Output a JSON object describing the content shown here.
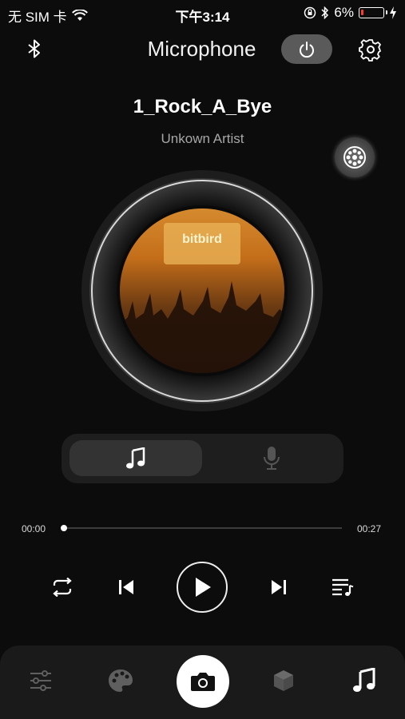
{
  "status_bar": {
    "carrier": "无 SIM 卡",
    "time": "下午3:14",
    "battery": "6%",
    "battery_level": 0.06,
    "battery_color": "#ff3b30"
  },
  "header": {
    "title": "Microphone",
    "icons": [
      "bluetooth-icon",
      "power-icon",
      "gear-icon"
    ]
  },
  "track": {
    "title": "1_Rock_A_Bye",
    "artist": "Unkown Artist",
    "album_art_label": "bitbird"
  },
  "mode_switch": {
    "options": [
      "music-note-icon",
      "microphone-icon"
    ],
    "selected": "music"
  },
  "progress": {
    "elapsed": "00:00",
    "total": "00:27",
    "fraction": 0.0
  },
  "controls": [
    "repeat-icon",
    "previous-icon",
    "play-icon",
    "next-icon",
    "playlist-icon"
  ],
  "tabbar": {
    "tabs": [
      "equalizer-icon",
      "palette-icon",
      "camera-icon",
      "cube-icon",
      "music-icon"
    ],
    "active": "music"
  }
}
